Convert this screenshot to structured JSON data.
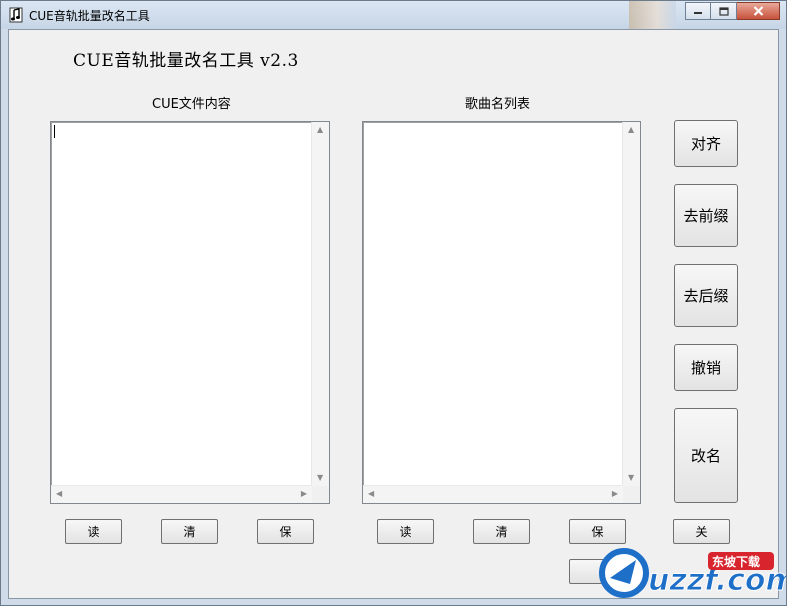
{
  "window": {
    "title": "CUE音轨批量改名工具",
    "minimize_icon": "minimize-icon",
    "maximize_icon": "maximize-icon",
    "close_icon": "close-icon"
  },
  "app": {
    "heading": "CUE音轨批量改名工具 v2.3"
  },
  "left_pane": {
    "label": "CUE文件内容",
    "content": ""
  },
  "right_pane": {
    "label": "歌曲名列表",
    "content": ""
  },
  "side_buttons": {
    "align": "对齐",
    "remove_prefix": "去前缀",
    "remove_suffix": "去后缀",
    "undo": "撤销",
    "rename": "改名"
  },
  "left_actions": {
    "read": "读",
    "clear": "清",
    "save": "保"
  },
  "right_actions": {
    "read": "读",
    "clear": "清",
    "save": "保"
  },
  "close_button": "关",
  "watermark": {
    "text": "uzzf.com",
    "sub": "东坡下载"
  },
  "colors": {
    "watermark_blue": "#1e6fc8",
    "watermark_red": "#d8242c",
    "window_frame": "#cfdbe8"
  }
}
